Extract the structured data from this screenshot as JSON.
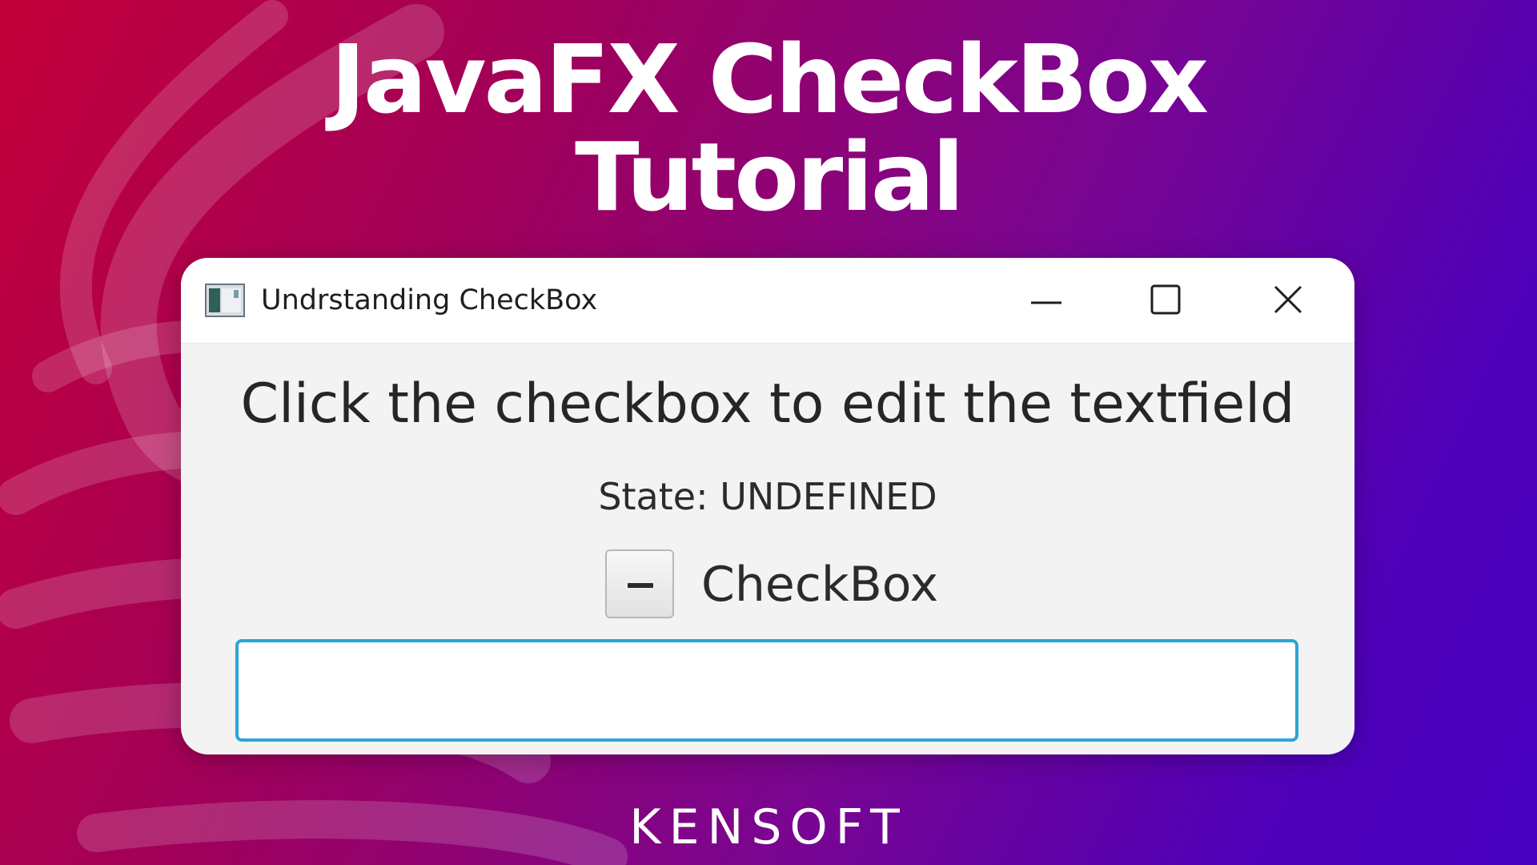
{
  "hero": {
    "line1": "JavaFX CheckBox",
    "line2": "Tutorial"
  },
  "window": {
    "title": "Undrstanding CheckBox",
    "icon": "app-window-icon",
    "controls": {
      "minimize_icon": "minimize-icon",
      "maximize_icon": "maximize-icon",
      "close_icon": "close-icon"
    }
  },
  "content": {
    "instruction": "Click the checkbox to edit the textfield",
    "state_label": "State: UNDEFINED",
    "checkbox": {
      "label": "CheckBox",
      "state": "indeterminate"
    },
    "textfield": {
      "value": "",
      "focus_color": "#2aa6d6"
    }
  },
  "brand": {
    "logo_text": "KENSOFT"
  },
  "colors": {
    "gradient_start": "#c4003a",
    "gradient_end": "#4600c0",
    "window_bg": "#f3f3f3"
  }
}
